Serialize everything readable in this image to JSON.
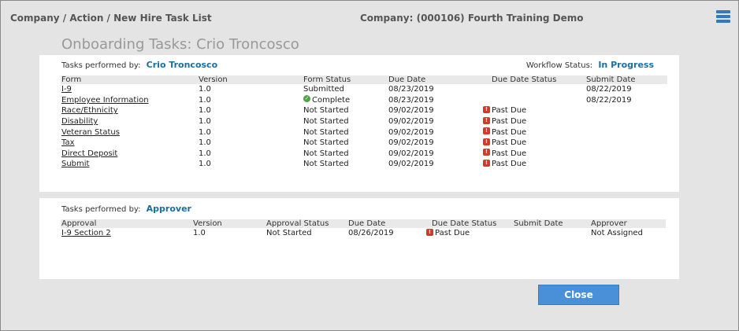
{
  "header": {
    "breadcrumb": "Company / Action / New Hire Task List",
    "company": "Company: (000106) Fourth Training Demo"
  },
  "page_title": "Onboarding Tasks:  Crio Troncosco",
  "section1": {
    "performed_label": "Tasks performed by:",
    "performed_by": "Crio Troncosco",
    "workflow_label": "Workflow Status:",
    "workflow_value": "In Progress",
    "columns": [
      "Form",
      "Version",
      "Form Status",
      "Due Date",
      "Due Date Status",
      "Submit Date"
    ],
    "rows": [
      {
        "form": "I-9",
        "version": "1.0",
        "status": "Submitted",
        "status_icon": "",
        "due": "08/23/2019",
        "due_status": "",
        "submit": "08/22/2019"
      },
      {
        "form": "Employee Information",
        "version": "1.0",
        "status": "Complete",
        "status_icon": "check-circle-icon",
        "due": "08/23/2019",
        "due_status": "",
        "submit": "08/22/2019"
      },
      {
        "form": "Race/Ethnicity",
        "version": "1.0",
        "status": "Not Started",
        "status_icon": "",
        "due": "09/02/2019",
        "due_status": "Past Due",
        "submit": ""
      },
      {
        "form": "Disability",
        "version": "1.0",
        "status": "Not Started",
        "status_icon": "",
        "due": "09/02/2019",
        "due_status": "Past Due",
        "submit": ""
      },
      {
        "form": "Veteran Status",
        "version": "1.0",
        "status": "Not Started",
        "status_icon": "",
        "due": "09/02/2019",
        "due_status": "Past Due",
        "submit": ""
      },
      {
        "form": "Tax",
        "version": "1.0",
        "status": "Not Started",
        "status_icon": "",
        "due": "09/02/2019",
        "due_status": "Past Due",
        "submit": ""
      },
      {
        "form": "Direct Deposit",
        "version": "1.0",
        "status": "Not Started",
        "status_icon": "",
        "due": "09/02/2019",
        "due_status": "Past Due",
        "submit": ""
      },
      {
        "form": "Submit",
        "version": "1.0",
        "status": "Not Started",
        "status_icon": "",
        "due": "09/02/2019",
        "due_status": "Past Due",
        "submit": ""
      }
    ]
  },
  "section2": {
    "performed_label": "Tasks performed by:",
    "performed_by": "Approver",
    "columns": [
      "Approval",
      "Version",
      "Approval Status",
      "Due Date",
      "Due Date Status",
      "Submit Date",
      "Approver"
    ],
    "rows": [
      {
        "approval": "I-9 Section 2",
        "version": "1.0",
        "status": "Not Started",
        "due": "08/26/2019",
        "due_status": "Past Due",
        "submit": "",
        "approver": "Not Assigned"
      }
    ]
  },
  "close_label": "Close",
  "colors": {
    "accent": "#1a6fa0",
    "button": "#4a90d9",
    "past_due": "#d23a2a",
    "complete": "#4ea644"
  }
}
